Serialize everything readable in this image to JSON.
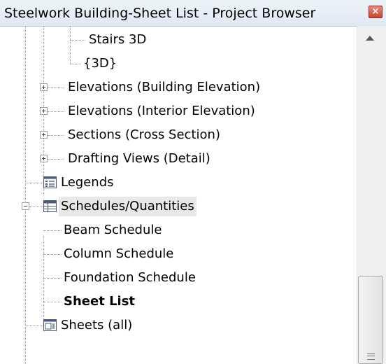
{
  "window": {
    "title": "Steelwork Building-Sheet List - Project Browser"
  },
  "tree": {
    "items": [
      {
        "label": "Stairs 3D",
        "icon": "none",
        "expander": "none"
      },
      {
        "label": "{3D}",
        "icon": "none",
        "expander": "none"
      },
      {
        "label": "Elevations (Building Elevation)",
        "icon": "none",
        "expander": "collapsed"
      },
      {
        "label": "Elevations (Interior Elevation)",
        "icon": "none",
        "expander": "collapsed"
      },
      {
        "label": "Sections (Cross Section)",
        "icon": "none",
        "expander": "collapsed"
      },
      {
        "label": "Drafting Views (Detail)",
        "icon": "none",
        "expander": "collapsed"
      },
      {
        "label": "Legends",
        "icon": "legend-icon",
        "expander": "none"
      },
      {
        "label": "Schedules/Quantities",
        "icon": "schedule-icon",
        "expander": "expanded",
        "selected_highlight": true
      },
      {
        "label": "Beam Schedule",
        "icon": "none",
        "expander": "none"
      },
      {
        "label": "Column Schedule",
        "icon": "none",
        "expander": "none"
      },
      {
        "label": "Foundation Schedule",
        "icon": "none",
        "expander": "none"
      },
      {
        "label": "Sheet List",
        "icon": "none",
        "expander": "none",
        "active": true
      },
      {
        "label": "Sheets (all)",
        "icon": "sheets-icon",
        "expander": "collapsed"
      }
    ]
  },
  "colors": {
    "title_bar": "#dfe8f4",
    "close_button": "#c7432f",
    "selection_highlight": "#e8e8e8",
    "tree_line": "#9a9a9a"
  }
}
